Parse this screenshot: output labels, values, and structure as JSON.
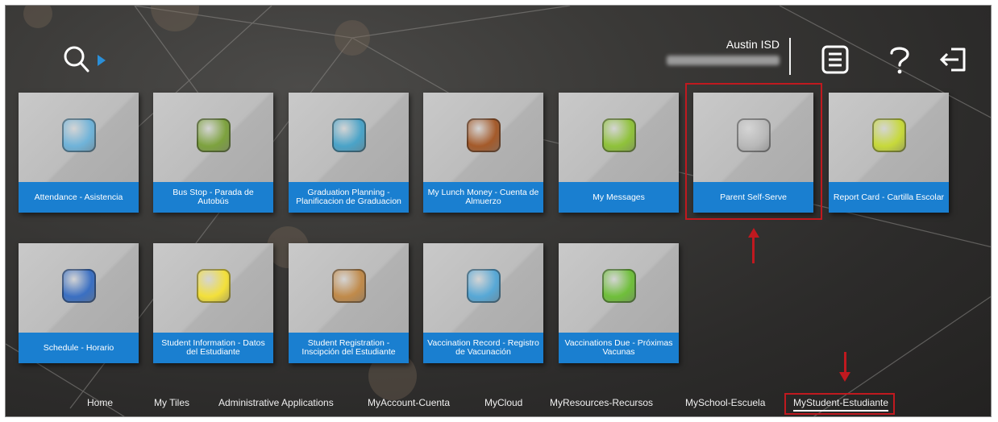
{
  "header": {
    "org_name": "Austin ISD",
    "user_name_redacted": true,
    "icons": [
      "search-icon",
      "menu-list-icon",
      "help-icon",
      "logout-icon"
    ]
  },
  "tiles": [
    {
      "label": "Attendance - Asistencia",
      "icon": "family-icon",
      "icon_color": "#6fb3d9"
    },
    {
      "label": "Bus Stop - Parada de Autobús",
      "icon": "school-bus-icon",
      "icon_color": "#7da23e"
    },
    {
      "label": "Graduation Planning - Planificacion de Graduacion",
      "icon": "graduation-cap-icon",
      "icon_color": "#4aa3c8"
    },
    {
      "label": "My Lunch Money - Cuenta de Almuerzo",
      "icon": "money-icon",
      "icon_color": "#a45a2a"
    },
    {
      "label": "My Messages",
      "icon": "megaphone-icon",
      "icon_color": "#8fc23a"
    },
    {
      "label": "Parent Self-Serve",
      "icon": "apple-icon",
      "icon_color": "#b9b9b9"
    },
    {
      "label": "Report Card - Cartilla Escolar",
      "icon": "abc-icon",
      "icon_color": "#c7d93a"
    },
    {
      "label": "Schedule - Horario",
      "icon": "clock-icon",
      "icon_color": "#3a6fc2"
    },
    {
      "label": "Student Information - Datos del Estudiante",
      "icon": "id-card-icon",
      "icon_color": "#f3e03a"
    },
    {
      "label": "Student Registration - Inscipción del Estudiante",
      "icon": "student-icon",
      "icon_color": "#c08a4a"
    },
    {
      "label": "Vaccination Record - Registro de Vacunación",
      "icon": "vaccine-record-icon",
      "icon_color": "#57a8d6"
    },
    {
      "label": "Vaccinations Due - Próximas Vacunas",
      "icon": "syringe-icon",
      "icon_color": "#6fbf3a"
    }
  ],
  "nav": {
    "items": [
      {
        "label": "Home"
      },
      {
        "label": "My Tiles"
      },
      {
        "label": "Administrative Applications"
      },
      {
        "label": "MyAccount-Cuenta"
      },
      {
        "label": "MyCloud"
      },
      {
        "label": "MyResources-Recursos"
      },
      {
        "label": "MySchool-Escuela"
      },
      {
        "label": "MyStudent-Estudiante",
        "active": true
      }
    ]
  },
  "colors": {
    "tile_label_bg": "#1a7fd0",
    "highlight": "#c0191f",
    "background": "#2f2e2c"
  }
}
